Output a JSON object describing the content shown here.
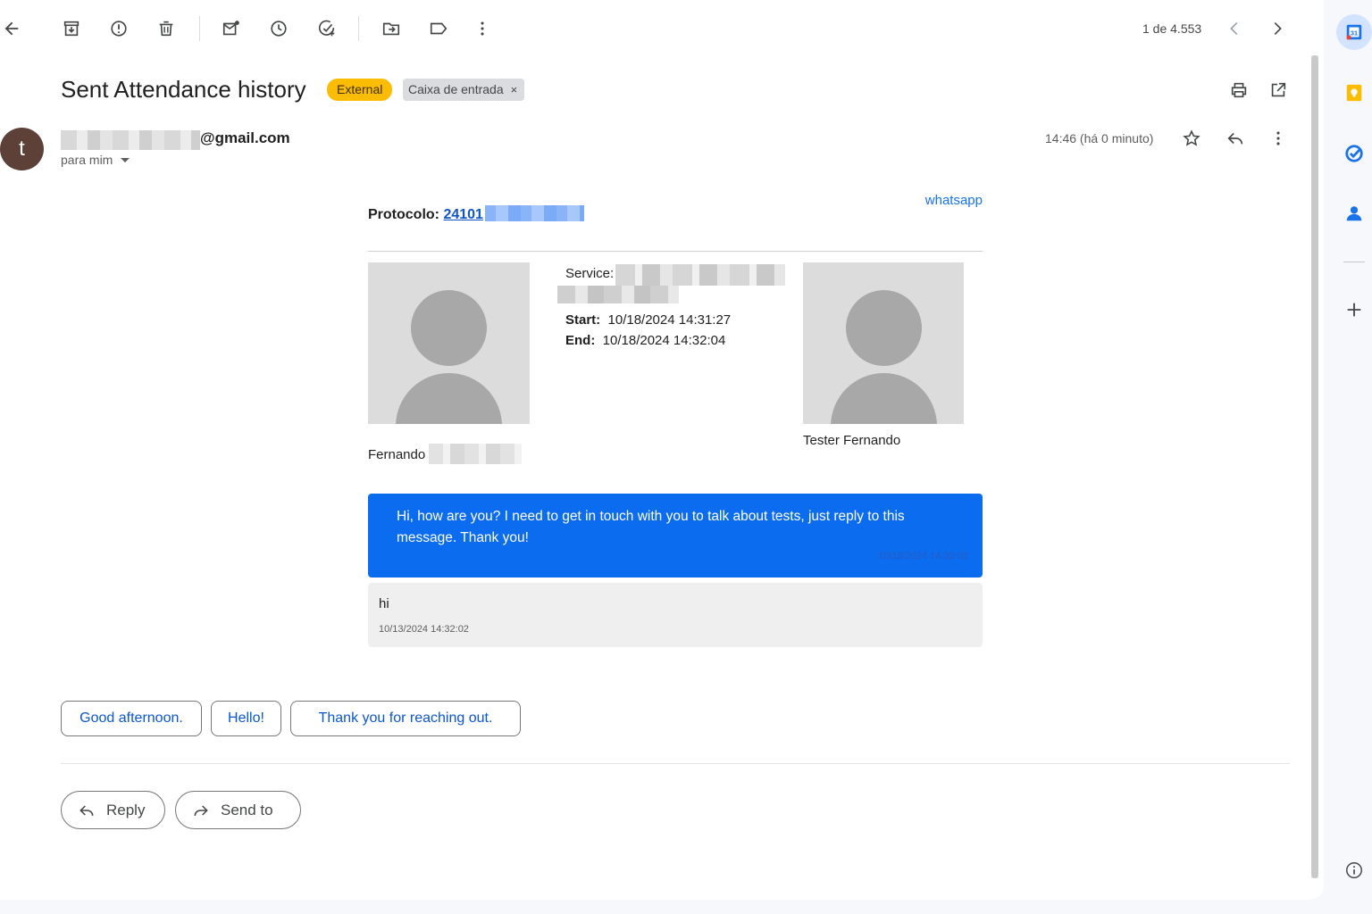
{
  "toolbar": {
    "pager": "1 de 4.553"
  },
  "email": {
    "subject": "Sent Attendance history",
    "label_external": "External",
    "label_inbox": "Caixa de entrada",
    "label_inbox_remove": "×",
    "avatar_letter": "t",
    "sender_domain": "@gmail.com",
    "to": "para mim",
    "time": "14:46 (há 0 minuto)"
  },
  "body": {
    "protocol_label": "Protocolo:",
    "protocol_value": "24101",
    "channel": "whatsapp",
    "service_label": "Service:",
    "start_label": "Start:",
    "start_value": "10/18/2024 14:31:27",
    "end_label": "End:",
    "end_value": "10/18/2024 14:32:04",
    "left_name": "Fernando",
    "right_name": "Tester Fernando",
    "messages": [
      {
        "text": "Hi, how are you? I need to get in touch with you to talk about tests, just reply to this message. Thank you!",
        "time": "10/18/2024 14:32:02"
      },
      {
        "text": "hi",
        "time": "10/13/2024 14:32:02"
      }
    ]
  },
  "smart_replies": [
    "Good afternoon.",
    "Hello!",
    "Thank you for reaching out."
  ],
  "actions": {
    "reply": "Reply",
    "forward": "Send to"
  },
  "colors": {
    "accent": "#0b57d0",
    "external_chip": "#fbbc04",
    "outgoing_bubble": "#0b6cf0",
    "avatar": "#5d4037"
  }
}
